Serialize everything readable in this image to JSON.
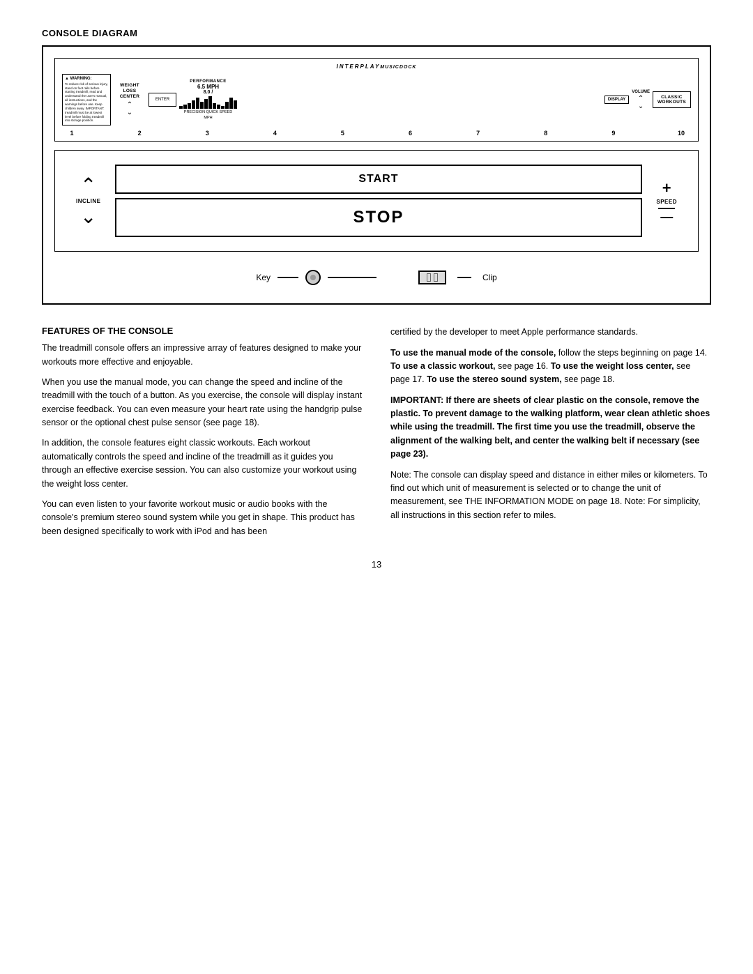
{
  "page": {
    "section_title": "CONSOLE DIAGRAM",
    "features_title": "FEATURES OF THE CONSOLE",
    "page_number": "13"
  },
  "console": {
    "musicdock_label": "INTERPLAY MUSICDOCK",
    "warning_title": "▲ WARNING:",
    "warning_text": "To reduce risk of serious injury, stand on foot rails before starting treadmill, read and understand the user's manual, all instructions, and the warnings before use. Keep children away. IMPORTANT: treadmill must be at lowest level before folding treadmill into storage position.",
    "weight_loss_center": "WEIGHT LOSS CENTER",
    "enter_label": "ENTER",
    "performance_label": "PERFORMANCE",
    "speed_display": "6.5 MPH",
    "speed_display2": "8.0 /",
    "precision_quick_speed": "PRECISION QUICK SPEED",
    "mph_label": "MPH",
    "display_label": "DISPLAY",
    "volume_label": "VOLUME",
    "classic_workouts": "CLASSIC WORKOUTS",
    "numbers": [
      "1",
      "2",
      "3",
      "4",
      "5",
      "6",
      "7",
      "8",
      "9",
      "10"
    ],
    "start_label": "START",
    "stop_label": "STOP",
    "incline_label": "INCLINE",
    "speed_control_label": "SPEED",
    "key_label": "Key",
    "clip_label": "Clip"
  },
  "text": {
    "para1": "The treadmill console offers an impressive array of features designed to make your workouts more effective and enjoyable.",
    "para2": "When you use the manual mode, you can change the speed and incline of the treadmill with the touch of a button. As you exercise, the console will display instant exercise feedback. You can even measure your heart rate using the handgrip pulse sensor or the optional chest pulse sensor (see page 18).",
    "para3": "In addition, the console features eight classic workouts. Each workout automatically controls the speed and incline of the treadmill as it guides you through an effective exercise session. You can also customize your workout using the weight loss center.",
    "para4": "You can even listen to your favorite workout music or audio books with the console's premium stereo sound system while you get in shape. This product has been designed specifically to work with iPod and has been",
    "para5": "certified by the developer to meet Apple performance standards.",
    "para6_bold": "To use the manual mode of the console,",
    "para6_rest": " follow the steps beginning on page 14.",
    "para6b_bold": " To use a classic workout,",
    "para6b_rest": " see page 16.",
    "para6c_bold": " To use the weight loss center,",
    "para6c_rest": " see page 17.",
    "para6d_bold": " To use the stereo sound system,",
    "para6d_rest": " see page 18.",
    "para7_bold": "IMPORTANT: If there are sheets of clear plastic on the console, remove the plastic. To prevent damage to the walking platform, wear clean athletic shoes while using the treadmill. The first time you use the treadmill, observe the alignment of the walking belt, and center the walking belt if necessary (see page 23).",
    "para8": "Note: The console can display speed and distance in either miles or kilometers. To find out which unit of measurement is selected or to change the unit of measurement, see THE INFORMATION MODE on page 18. Note: For simplicity, all instructions in this section refer to miles."
  }
}
